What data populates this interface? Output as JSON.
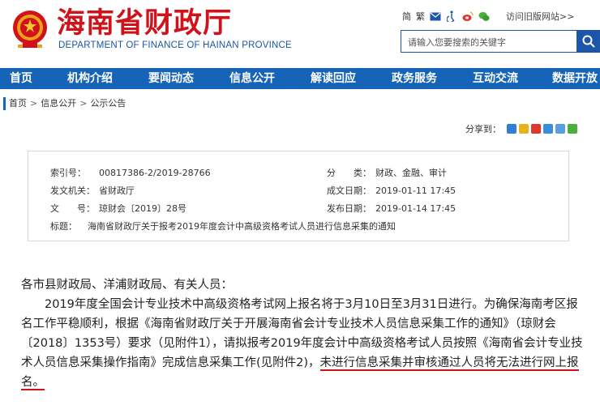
{
  "header": {
    "logo_cn": "海南省财政厅",
    "logo_en": "DEPARTMENT OF FINANCE OF HAINAN PROVINCE",
    "toplinks": {
      "simplified": "简",
      "traditional": "繁",
      "old_site": "访问旧版网站>>"
    },
    "search_placeholder": "请输入您要搜索的关键字"
  },
  "nav": {
    "items": [
      "首页",
      "机构介绍",
      "要闻动态",
      "信息公开",
      "解读回应",
      "政务服务",
      "互动交流",
      "数据开放"
    ]
  },
  "breadcrumb": {
    "items": [
      "首页",
      "信息公开",
      "公示公告"
    ],
    "sep": ">"
  },
  "share": {
    "label": "分享到："
  },
  "info": {
    "index_key": "索引号：",
    "index_val": "00817386-2/2019-28766",
    "category_key": "分　　类：",
    "category_val": "财政、金融、审计",
    "issuer_key": "发文机关：",
    "issuer_val": "省财政厅",
    "created_key": "成文日期：",
    "created_val": "2019-01-11 17:45",
    "docno_key": "文　　号：",
    "docno_val": "琼财会〔2019〕28号",
    "published_key": "发布日期：",
    "published_val": "2019-01-14 17:45",
    "title_key": "标题：",
    "title_val": "海南省财政厅关于报考2019年度会计中高级资格考试人员进行信息采集的通知"
  },
  "content": {
    "salutation": "各市县财政局、洋浦财政局、有关人员：",
    "para1_a": "2019年度全国会计专业技术中高级资格考试网上报名将于3月10日至3月31日进行。为确保海南考区报名工作平稳顺利，根据《海南省财政厅关于开展海南省会计专业技术人员信息采集工作的通知》（琼财会〔2018〕1353号）要求（见附件1），请拟报考2019年度会计中高级资格考试人员按照《海南省会计专业技术人员信息采集操作指南》完成信息采集工作(见附件2)，",
    "para1_b": "未进行信息采集并审核通过人员将无法进行网上报名。"
  },
  "colors": {
    "brand_red": "#d0121b",
    "brand_blue": "#1664b8"
  }
}
